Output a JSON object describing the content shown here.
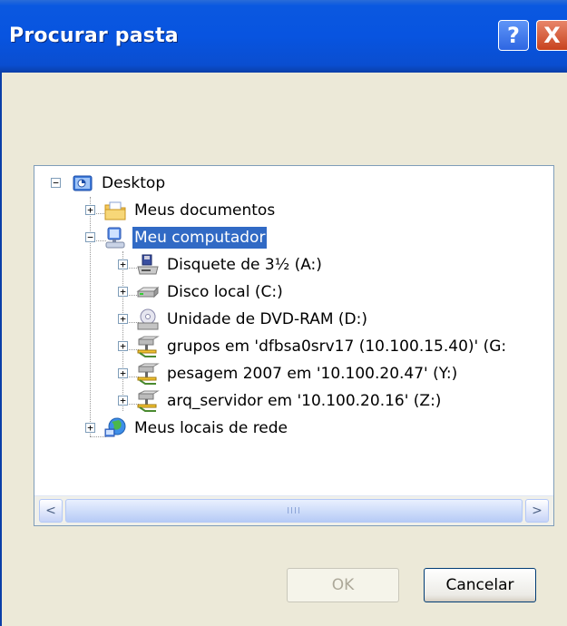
{
  "window": {
    "title": "Procurar pasta",
    "help_button": "?",
    "close_button": "X"
  },
  "tree": {
    "root": "Desktop",
    "items": [
      {
        "label": "Meus documentos",
        "icon": "my-documents-icon"
      },
      {
        "label": "Meu computador",
        "icon": "my-computer-icon",
        "selected": true
      },
      {
        "label": "Disquete de 3½ (A:)",
        "icon": "floppy-drive-icon"
      },
      {
        "label": "Disco local (C:)",
        "icon": "hard-drive-icon"
      },
      {
        "label": "Unidade de DVD-RAM (D:)",
        "icon": "dvd-drive-icon"
      },
      {
        "label": "grupos em 'dfbsa0srv17 (10.100.15.40)' (G:",
        "icon": "network-drive-icon"
      },
      {
        "label": "pesagem 2007 em '10.100.20.47' (Y:)",
        "icon": "network-drive-icon"
      },
      {
        "label": "arq_servidor em '10.100.20.16' (Z:)",
        "icon": "network-drive-icon"
      },
      {
        "label": "Meus locais de rede",
        "icon": "network-places-icon"
      }
    ]
  },
  "scrollbar": {
    "left_arrow": "<",
    "right_arrow": ">",
    "grip": "IIII"
  },
  "buttons": {
    "ok": "OK",
    "cancel": "Cancelar"
  }
}
